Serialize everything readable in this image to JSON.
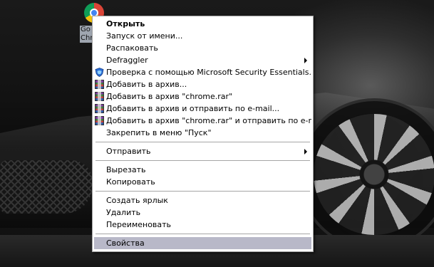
{
  "desktop": {
    "icon_label": "Go\nChr"
  },
  "context_menu": {
    "items": [
      {
        "label": "Открыть",
        "bold": true
      },
      {
        "label": "Запуск от имени..."
      },
      {
        "label": "Распаковать"
      },
      {
        "label": "Defraggler",
        "submenu": true
      },
      {
        "label": "Проверка с помощью Microsoft Security Essentials...",
        "icon": "security-essentials-icon"
      },
      {
        "label": "Добавить в архив...",
        "icon": "winrar-icon"
      },
      {
        "label": "Добавить в архив \"chrome.rar\"",
        "icon": "winrar-icon"
      },
      {
        "label": "Добавить в архив и отправить по e-mail...",
        "icon": "winrar-icon"
      },
      {
        "label": "Добавить в архив \"chrome.rar\" и отправить по e-mail",
        "icon": "winrar-icon"
      },
      {
        "label": "Закрепить в меню \"Пуск\""
      },
      {
        "label": "Отправить",
        "submenu": true
      },
      {
        "label": "Вырезать"
      },
      {
        "label": "Копировать"
      },
      {
        "label": "Создать ярлык"
      },
      {
        "label": "Удалить"
      },
      {
        "label": "Переименовать"
      },
      {
        "label": "Свойства",
        "highlighted": true
      }
    ]
  },
  "colors": {
    "highlight": "#b8b8c8",
    "menu_bg": "#ffffff",
    "separator": "#a6a6a6"
  }
}
